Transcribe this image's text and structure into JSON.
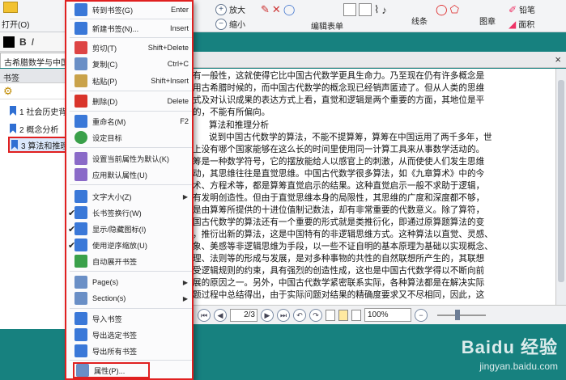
{
  "ribbon": {
    "open_label": "打开(O)",
    "zoom_in_label": "放大",
    "zoom_out_label": "缩小",
    "edit_form_label": "编辑表单",
    "line_label": "线条",
    "stamp_label": "图章",
    "pencil_label": "铅笔",
    "eraser_label": "面积"
  },
  "format_bar": {
    "bold": "B",
    "italic": "I"
  },
  "doc_tab": {
    "title": "古希腊数学与中国古",
    "close": "×"
  },
  "bookmark_panel": {
    "header": "书签",
    "items": [
      {
        "label": "1 社会历史背"
      },
      {
        "label": "2 概念分析"
      },
      {
        "label": "3 算法和推理"
      }
    ]
  },
  "document": {
    "lines": [
      "有一般性，这就使得它比中国古代数学更具生命力。乃至现在仍有许多概念是",
      "用古希腊时候的，而中国古代数学的概念现已经销声匿迹了。但从人类的思维",
      "式及对认识成果的表达方式上看，直觉和逻辑是两个重要的方面，其地位是平",
      "的，不能有所偏向。",
      "算法和推理分析",
      "说到中国古代数学的算法，不能不提算筹，算筹在中国运用了两千多年，世",
      "上没有哪个国家能够在这么长的时间里使用同一计算工具来从事数学活动的。",
      "筹是一种数学符号，它的摆放能给人以感官上的刺激，从而使使人们发生思维",
      "动，其思维往往是直觉思维。中国古代数学很多算法，如《九章算术》中的今",
      "术、方程术等，都是算筹直觉启示的结果。这种直觉启示一般不求助于逻辑，",
      "有发明创造性。但由于直觉思维本身的局限性，其思维的广度和深度都不够，",
      "是由算筹所提供的十进位值制记数法，却有非常重要的代数意义。除了算符，",
      "国古代数学的算法还有一个重要的形式就是类推衍化，即通过原算题算法的变",
      "，推衍出新的算法，这是中国特有的非逻辑思维方式。这种算法以直觉、灵感、",
      "象、美感等非逻辑思维为手段，以一些不证自明的基本原理为基础以实现概念、",
      "理、法则等的形成与发展，是对多种事物的共性的自然联想所产生的，其联想",
      "受逻辑规则的约束，具有强烈的创造性成，这也是中国古代数学得以不断向前",
      "展的原因之一。另外，中国古代数学紧密联系实际，各种算法都是在解决实际",
      "题过程中总结得出，由于实际问题对结果的精确度要求又不尽相同，因此，这"
    ]
  },
  "navbar": {
    "page_value": "2/3",
    "zoom_value": "100%"
  },
  "watermark": {
    "brand": "Baidu 经验",
    "url": "jingyan.baidu.com"
  },
  "context_menu": {
    "items": [
      {
        "label": "转到书签(G)",
        "shortcut": "Enter",
        "color": "#3a78d8"
      },
      {
        "label": "新建书签(N)...",
        "shortcut": "Insert",
        "color": "#3a78d8"
      },
      {
        "label": "剪切(T)",
        "shortcut": "Shift+Delete",
        "color": "#d44"
      },
      {
        "label": "复制(C)",
        "shortcut": "Ctrl+C",
        "color": "#6a8fc6"
      },
      {
        "label": "粘贴(P)",
        "shortcut": "Shift+Insert",
        "color": "#c9a24a"
      },
      {
        "label": "删除(D)",
        "shortcut": "Delete",
        "color": "#d9342b"
      },
      {
        "label": "重命名(M)",
        "shortcut": "F2",
        "color": "#3a78d8"
      },
      {
        "label": "设定目标",
        "shortcut": "",
        "color": "#3aa04a"
      },
      {
        "label": "设置当前属性为默认(K)",
        "shortcut": "",
        "color": "#8a6ac8"
      },
      {
        "label": "应用默认属性(U)",
        "shortcut": "",
        "color": "#8a6ac8"
      },
      {
        "label": "文字大小(Z)",
        "shortcut": "",
        "color": "#3a78d8"
      },
      {
        "label": "长书签换行(W)",
        "shortcut": "",
        "color": "#3a78d8"
      },
      {
        "label": "显示/隐藏图标(I)",
        "shortcut": "",
        "color": "#3a78d8"
      },
      {
        "label": "使用逆序缩放(U)",
        "shortcut": "",
        "color": "#3a78d8"
      },
      {
        "label": "自动展开书签",
        "shortcut": "",
        "color": "#3aa04a"
      },
      {
        "label": "Page(s)",
        "shortcut": "",
        "color": "#6a8fc6"
      },
      {
        "label": "Section(s)",
        "shortcut": "",
        "color": "#6a8fc6"
      },
      {
        "label": "导入书签",
        "shortcut": "",
        "color": "#3a78d8"
      },
      {
        "label": "导出选定书签",
        "shortcut": "",
        "color": "#3a78d8"
      },
      {
        "label": "导出所有书签",
        "shortcut": "",
        "color": "#3a78d8"
      },
      {
        "label": "属性(P)...",
        "shortcut": "",
        "color": "#6a8fc6"
      }
    ],
    "submenu_arrow": "▶",
    "check": "✔"
  },
  "colors": {
    "teal": "#17817f",
    "highlight_red": "#e02020"
  }
}
